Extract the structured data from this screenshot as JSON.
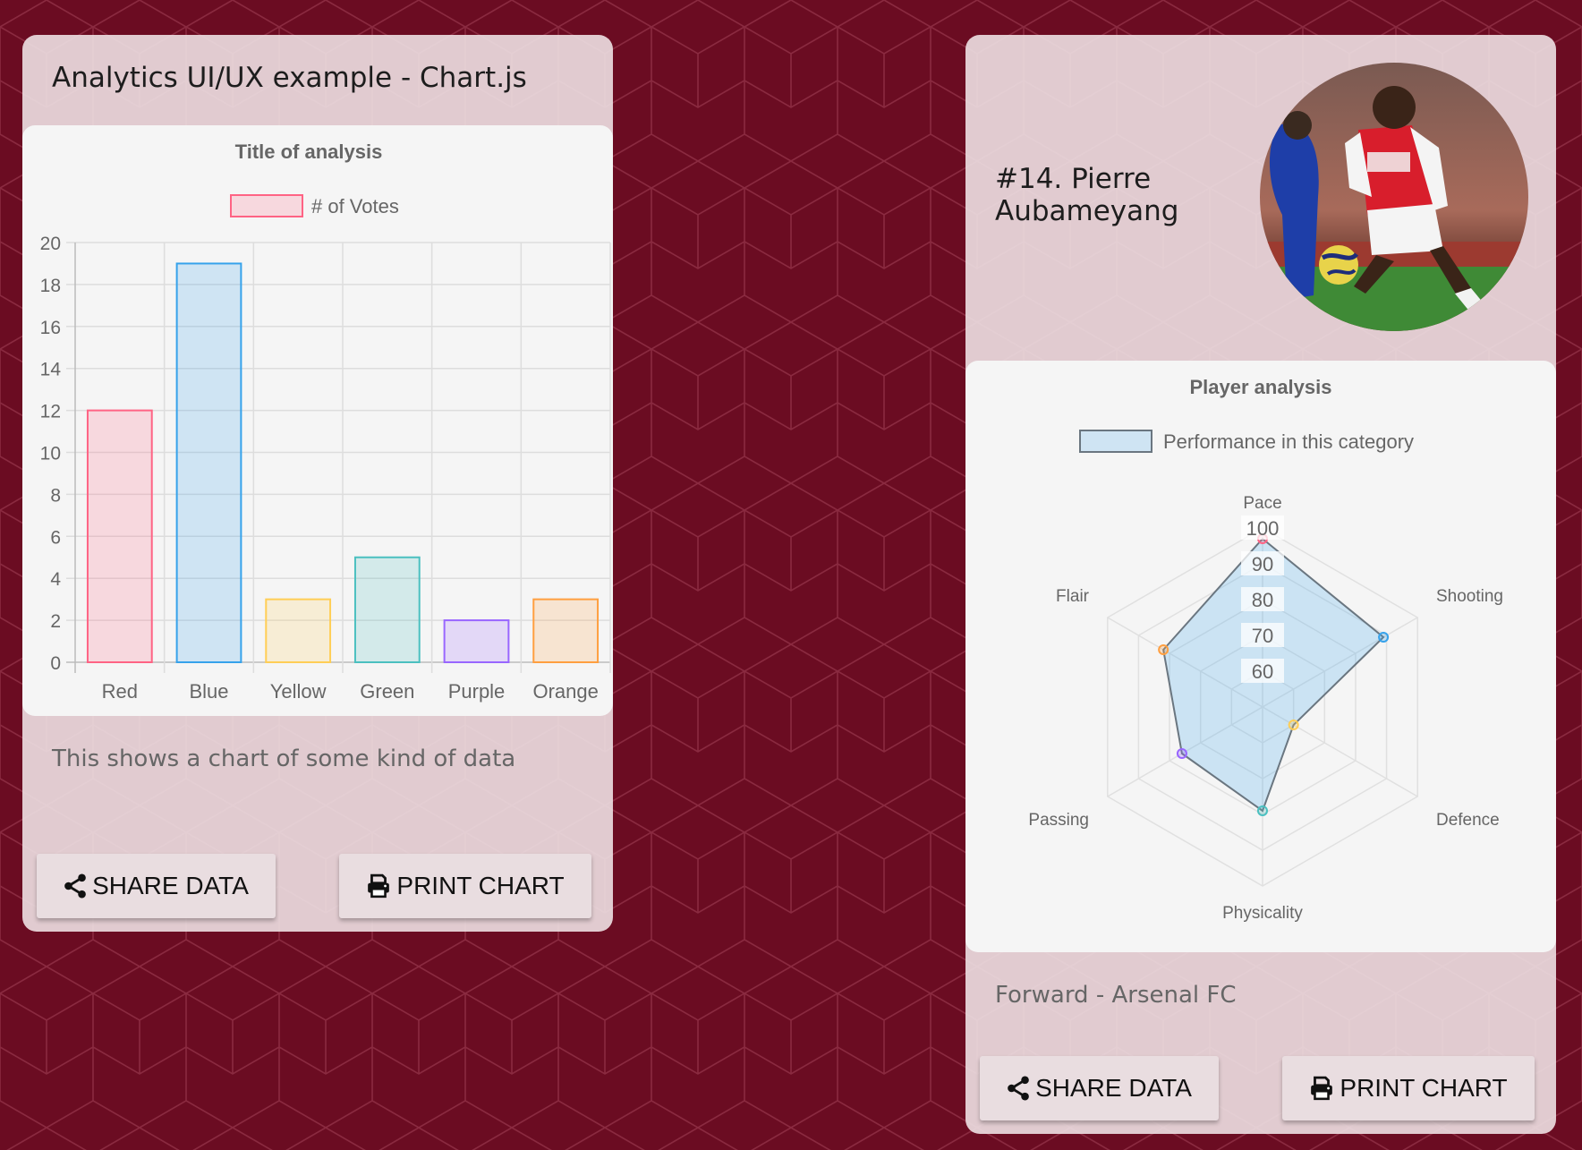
{
  "left_card": {
    "title": "Analytics UI/UX example - Chart.js",
    "description": "This shows a chart of some kind of data",
    "share_label": "SHARE DATA",
    "print_label": "PRINT CHART"
  },
  "right_card": {
    "player_name": "#14. Pierre Aubameyang",
    "description": "Forward - Arsenal FC",
    "share_label": "SHARE DATA",
    "print_label": "PRINT CHART"
  },
  "colors": {
    "background": "#6b0c22",
    "card": "#ecdce0",
    "red": "#ff6384",
    "blue": "#36a2eb",
    "yellow": "#ffce56",
    "green": "#4bc0c0",
    "purple": "#9966ff",
    "orange": "#ff9f40"
  },
  "icons": {
    "share": "share-icon",
    "print": "printer-icon"
  },
  "chart_data": [
    {
      "type": "bar",
      "title": "Title of analysis",
      "legend": "# of Votes",
      "legend_position": "top",
      "categories": [
        "Red",
        "Blue",
        "Yellow",
        "Green",
        "Purple",
        "Orange"
      ],
      "series": [
        {
          "name": "# of Votes",
          "values": [
            12,
            19,
            3,
            5,
            2,
            3
          ]
        }
      ],
      "ylim": [
        0,
        20
      ],
      "yticks": [
        0,
        2,
        4,
        6,
        8,
        10,
        12,
        14,
        16,
        18,
        20
      ],
      "grid": true
    },
    {
      "type": "radar",
      "title": "Player analysis",
      "legend": "Performance in this category",
      "legend_position": "top",
      "categories": [
        "Pace",
        "Shooting",
        "Defence",
        "Physicality",
        "Passing",
        "Flair"
      ],
      "series": [
        {
          "name": "Performance in this category",
          "values": [
            97,
            89,
            60,
            79,
            76,
            82
          ]
        }
      ],
      "rlim": [
        50,
        100
      ],
      "rticks": [
        60,
        70,
        80,
        90,
        100
      ],
      "grid": true
    }
  ]
}
